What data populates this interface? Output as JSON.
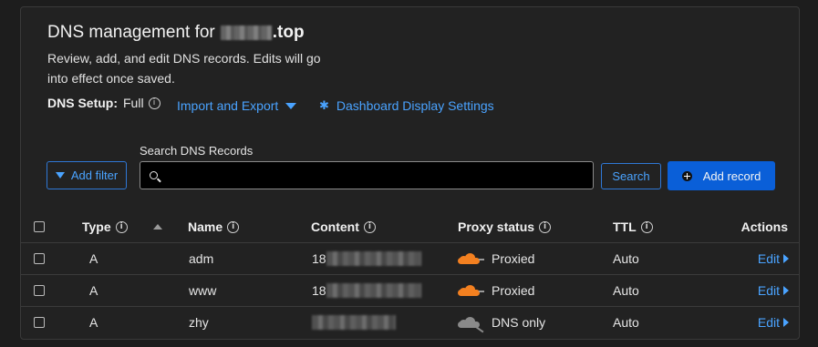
{
  "header": {
    "title_prefix": "DNS management for",
    "title_domain": ".top",
    "description": "Review, add, and edit DNS records. Edits will go into effect once saved.",
    "dns_setup_label": "DNS Setup:",
    "dns_setup_value": "Full",
    "import_export_label": "Import and Export",
    "dashboard_settings_label": "Dashboard Display Settings"
  },
  "toolbar": {
    "search_label": "Search DNS Records",
    "search_value": "",
    "add_filter_label": "Add filter",
    "search_button_label": "Search",
    "add_record_label": "Add record"
  },
  "table": {
    "columns": {
      "type": "Type",
      "name": "Name",
      "content": "Content",
      "proxy_status": "Proxy status",
      "ttl": "TTL",
      "actions": "Actions"
    },
    "rows": [
      {
        "type": "A",
        "name": "adm",
        "content": "18",
        "proxy_status": "Proxied",
        "proxied": true,
        "ttl": "Auto",
        "action": "Edit"
      },
      {
        "type": "A",
        "name": "www",
        "content": "18",
        "proxy_status": "Proxied",
        "proxied": true,
        "ttl": "Auto",
        "action": "Edit"
      },
      {
        "type": "A",
        "name": "zhy",
        "content": "",
        "proxy_status": "DNS only",
        "proxied": false,
        "ttl": "Auto",
        "action": "Edit"
      }
    ]
  },
  "icons": {
    "info": "info-circle-icon",
    "caret": "caret-down-icon",
    "gear": "gear-icon",
    "filter": "funnel-icon",
    "search": "search-icon",
    "add": "plus-circle-icon",
    "sort": "sort-ascending-icon",
    "proxied": "orange-cloud-icon",
    "dns_only": "grey-cloud-icon",
    "edit": "chevron-right-icon"
  },
  "colors": {
    "accent": "#4aa3ff",
    "primary_button": "#0a5fd8",
    "proxied_cloud": "#f38020",
    "dns_only_cloud": "#8a8a8a"
  }
}
